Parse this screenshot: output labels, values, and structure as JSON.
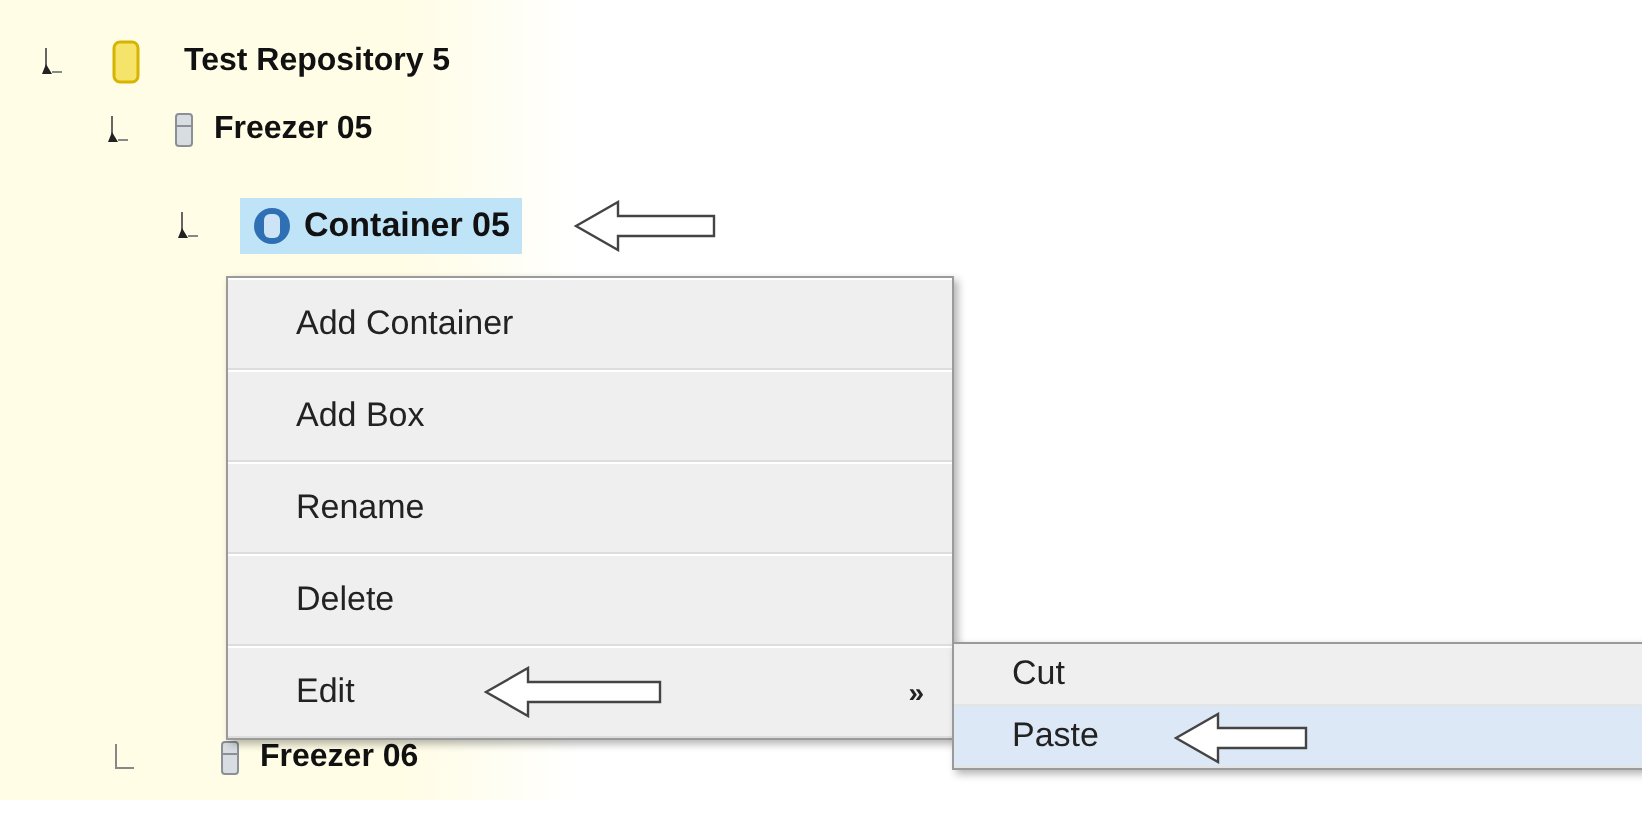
{
  "tree": [
    {
      "label": "Test Repository 5",
      "kind": "repository",
      "expanded": true,
      "selected": false,
      "children": [
        {
          "label": "Freezer 05",
          "kind": "freezer",
          "expanded": true,
          "selected": false,
          "children": [
            {
              "label": "Container 05",
              "kind": "container",
              "expanded": true,
              "selected": false,
              "highlighted": true
            }
          ]
        },
        {
          "label": "Freezer 06",
          "kind": "freezer",
          "expanded": false,
          "selected": false
        }
      ]
    }
  ],
  "context_menu": {
    "items": [
      {
        "label": "Add Container"
      },
      {
        "label": "Add Box"
      },
      {
        "label": "Rename"
      },
      {
        "label": "Delete"
      },
      {
        "label": "Edit",
        "submenu_glyph": "»"
      }
    ]
  },
  "submenu": {
    "items": [
      {
        "label": "Cut",
        "selected": false
      },
      {
        "label": "Paste",
        "selected": true
      }
    ]
  }
}
